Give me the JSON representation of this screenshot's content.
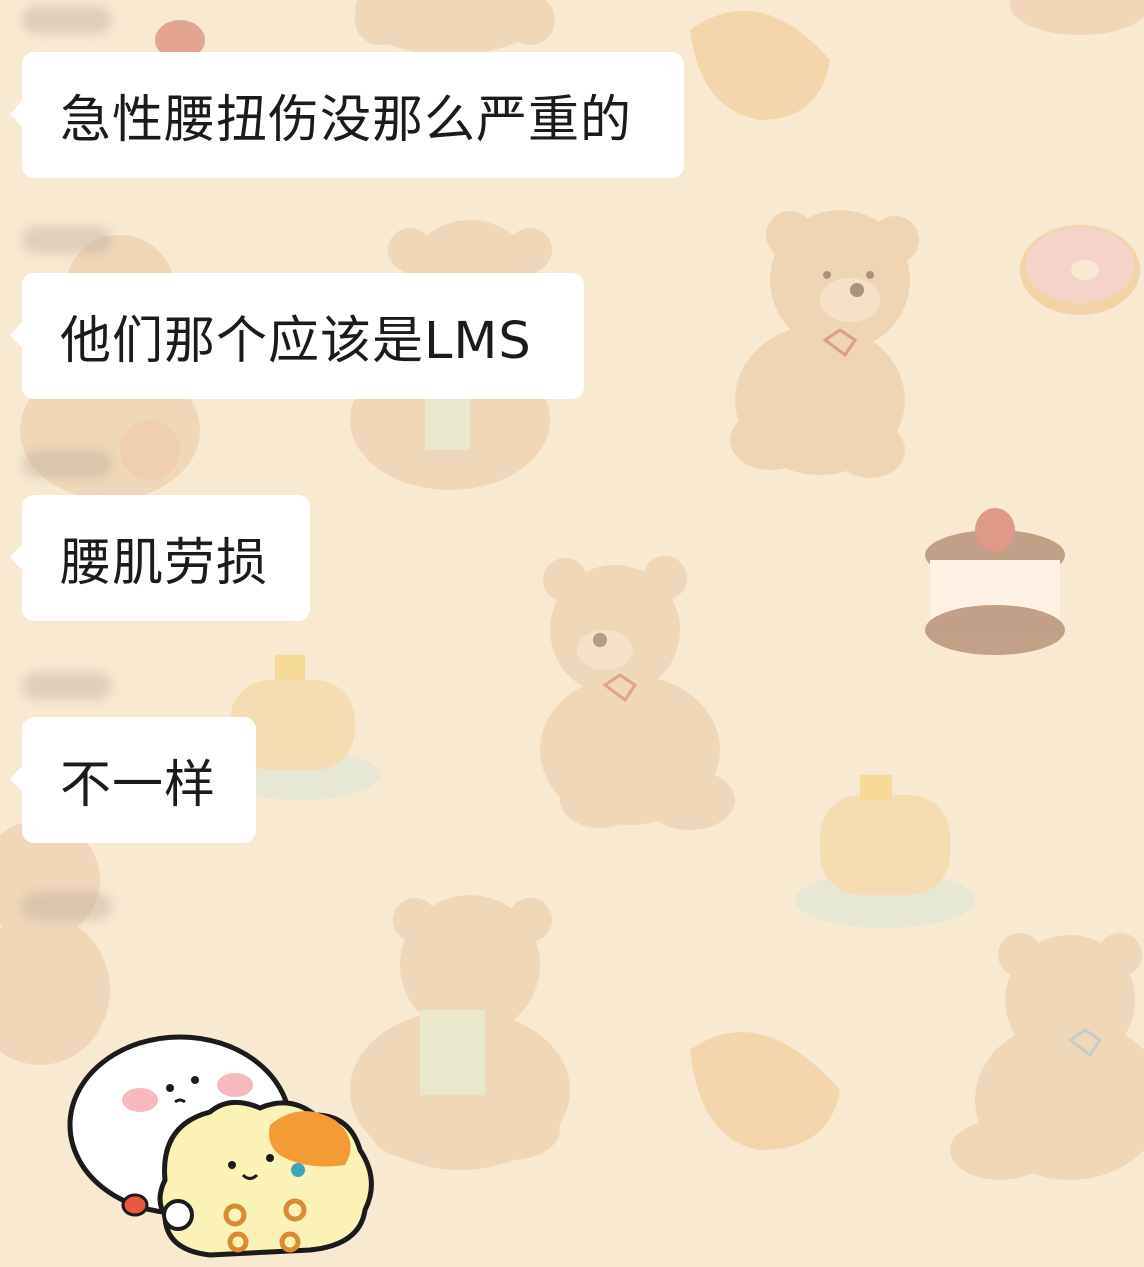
{
  "chat": {
    "messages": [
      {
        "text": "急性腰扭伤没那么严重的"
      },
      {
        "text": "他们那个应该是LMS"
      },
      {
        "text": "腰肌劳损"
      },
      {
        "text": "不一样"
      }
    ],
    "sticker": {
      "icon": "duck-and-chick-sticker-icon"
    },
    "background": {
      "color": "#f8e9d3",
      "pattern": "teddy-bear-and-dessert-wallpaper"
    }
  }
}
